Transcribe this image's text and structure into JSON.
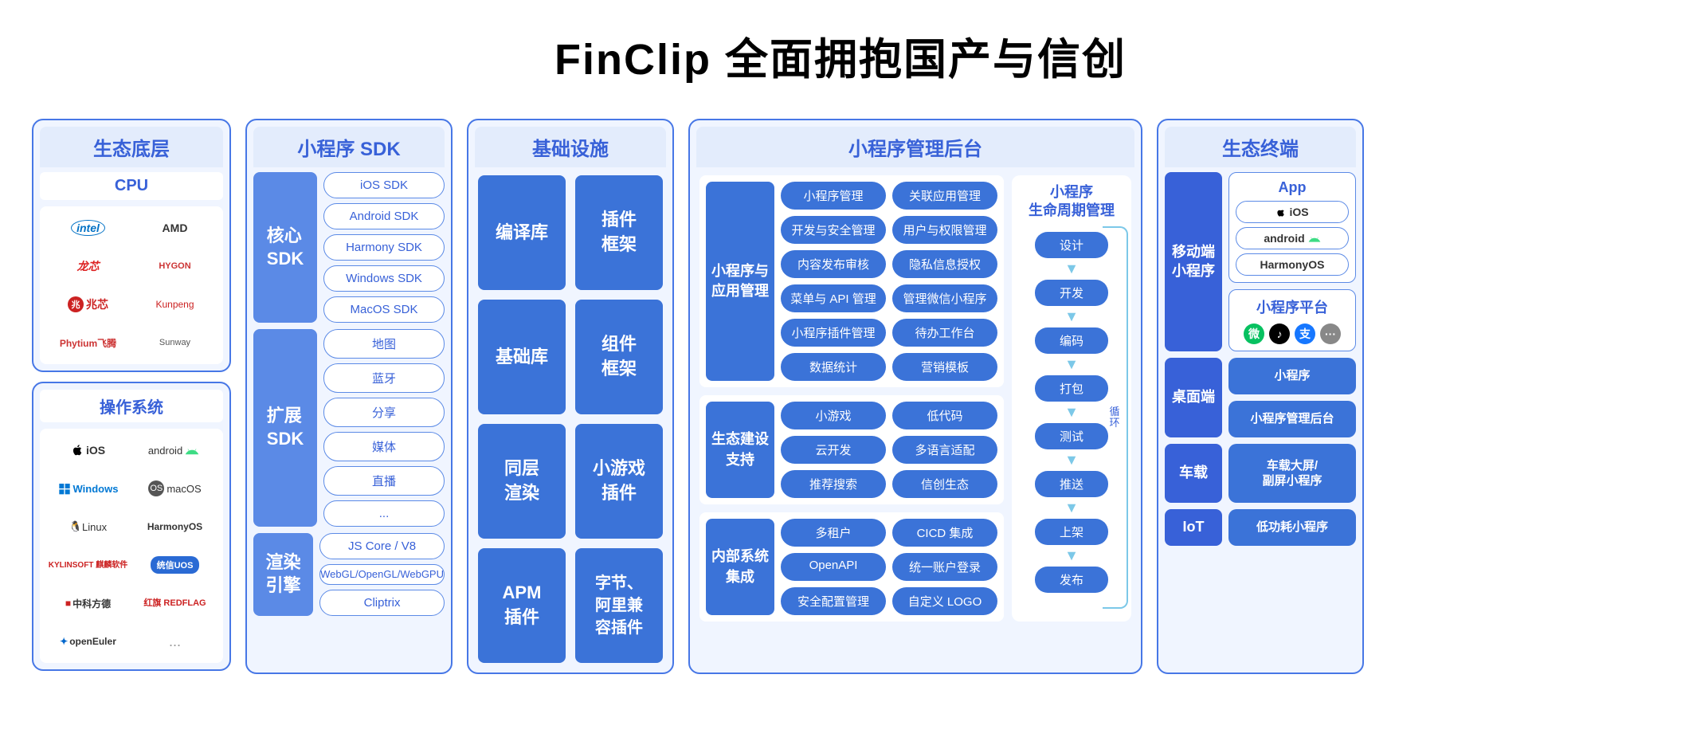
{
  "title": "FinClip 全面拥抱国产与信创",
  "ecosystem_base": {
    "header": "生态底层",
    "cpu": {
      "label": "CPU",
      "items": [
        "intel",
        "AMD",
        "龙芯",
        "HYGON",
        "兆芯",
        "Kunpeng",
        "Phytium飞腾",
        "Sunway"
      ]
    },
    "os": {
      "label": "操作系统",
      "items": [
        "iOS",
        "android",
        "Windows",
        "macOS",
        "Linux",
        "HarmonyOS",
        "KYLINSOFT 麒麟软件",
        "统信UOS",
        "中科方德",
        "红旗 REDFLAG",
        "openEuler",
        "..."
      ]
    }
  },
  "sdk": {
    "header": "小程序 SDK",
    "core": {
      "label": "核心\nSDK",
      "items": [
        "iOS SDK",
        "Android SDK",
        "Harmony SDK",
        "Windows SDK",
        "MacOS SDK"
      ]
    },
    "ext": {
      "label": "扩展\nSDK",
      "items": [
        "地图",
        "蓝牙",
        "分享",
        "媒体",
        "直播",
        "..."
      ]
    },
    "render": {
      "label": "渲染\n引擎",
      "items": [
        "JS Core / V8",
        "WebGL/OpenGL/WebGPU",
        "Cliptrix"
      ]
    }
  },
  "infra": {
    "header": "基础设施",
    "items": [
      "编译库",
      "插件\n框架",
      "基础库",
      "组件\n框架",
      "同层\n渲染",
      "小游戏\n插件",
      "APM\n插件",
      "字节、\n阿里兼\n容插件"
    ]
  },
  "mgmt": {
    "header": "小程序管理后台",
    "app": {
      "label": "小程序与\n应用管理",
      "items": [
        "小程序管理",
        "关联应用管理",
        "开发与安全管理",
        "用户与权限管理",
        "内容发布审核",
        "隐私信息授权",
        "菜单与 API 管理",
        "管理微信小程序",
        "小程序插件管理",
        "待办工作台",
        "数据统计",
        "营销模板"
      ]
    },
    "eco": {
      "label": "生态建设\n支持",
      "items": [
        "小游戏",
        "低代码",
        "云开发",
        "多语言适配",
        "推荐搜索",
        "信创生态"
      ]
    },
    "internal": {
      "label": "内部系统\n集成",
      "items": [
        "多租户",
        "CICD 集成",
        "OpenAPI",
        "统一账户登录",
        "安全配置管理",
        "自定义 LOGO"
      ]
    }
  },
  "lifecycle": {
    "header": "小程序\n生命周期管理",
    "loop": "循\n环",
    "steps": [
      "设计",
      "开发",
      "编码",
      "打包",
      "测试",
      "推送",
      "上架",
      "发布"
    ]
  },
  "terminal": {
    "header": "生态终端",
    "mobile": {
      "label": "移动端\n小程序",
      "app_label": "App",
      "os": [
        "iOS",
        "android",
        "HarmonyOS"
      ],
      "platform": "小程序平台",
      "icons": [
        "微",
        "♪",
        "支",
        "···"
      ]
    },
    "desktop": {
      "label": "桌面端",
      "items": [
        "小程序",
        "小程序管理后台"
      ]
    },
    "car": {
      "label": "车载",
      "item": "车载大屏/\n副屏小程序"
    },
    "iot": {
      "label": "IoT",
      "item": "低功耗小程序"
    }
  }
}
